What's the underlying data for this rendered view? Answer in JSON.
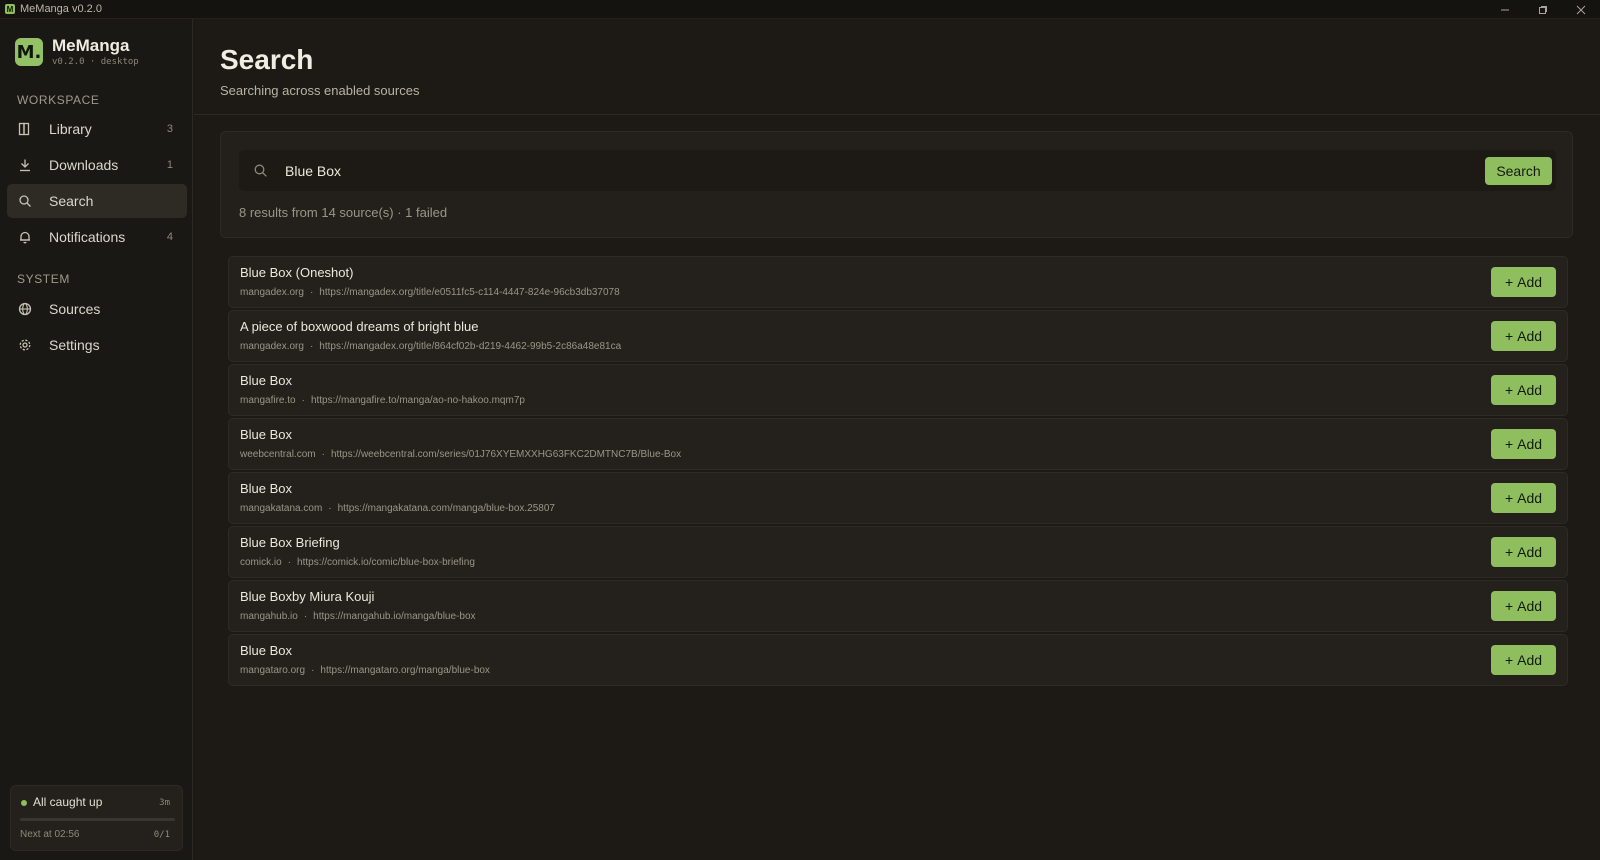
{
  "window": {
    "title": "MeManga v0.2.0",
    "logo_letter": "M",
    "controls": [
      "minimize-icon",
      "restore-icon",
      "close-icon"
    ]
  },
  "brand": {
    "logo_letter": "M.",
    "name": "MeManga",
    "version": "v0.2.0 · desktop",
    "accent_color": "#93c266"
  },
  "sidebar": {
    "workspace_label": "WORKSPACE",
    "workspace_items": [
      {
        "label": "Library",
        "count": "3",
        "icon": "book-icon"
      },
      {
        "label": "Downloads",
        "count": "1",
        "icon": "download-icon"
      },
      {
        "label": "Search",
        "count": "",
        "icon": "search-icon",
        "active": true
      },
      {
        "label": "Notifications",
        "count": "4",
        "icon": "bell-icon"
      }
    ],
    "system_label": "SYSTEM",
    "system_items": [
      {
        "label": "Sources",
        "icon": "globe-icon"
      },
      {
        "label": "Settings",
        "icon": "gear-icon"
      }
    ],
    "status": {
      "text": "All caught up",
      "age": "3m",
      "next": "Next at 02:56",
      "progress_text": "0/1",
      "progress_fraction": 0
    }
  },
  "page": {
    "title": "Search",
    "subtitle": "Searching across enabled sources"
  },
  "search": {
    "value": "Blue Box",
    "placeholder": "",
    "button_label": "Search",
    "summary": "8 results from 14 source(s)  ·  1 failed"
  },
  "results": [
    {
      "title": "Blue Box (Oneshot)",
      "source": "mangadex.org",
      "url": "https://mangadex.org/title/e0511fc5-c114-4447-824e-96cb3db37078"
    },
    {
      "title": "A piece of boxwood dreams of bright blue",
      "source": "mangadex.org",
      "url": "https://mangadex.org/title/864cf02b-d219-4462-99b5-2c86a48e81ca"
    },
    {
      "title": "Blue Box",
      "source": "mangafire.to",
      "url": "https://mangafire.to/manga/ao-no-hakoo.mqm7p"
    },
    {
      "title": "Blue Box",
      "source": "weebcentral.com",
      "url": "https://weebcentral.com/series/01J76XYEMXXHG63FKC2DMTNC7B/Blue-Box"
    },
    {
      "title": "Blue Box",
      "source": "mangakatana.com",
      "url": "https://mangakatana.com/manga/blue-box.25807"
    },
    {
      "title": "Blue Box Briefing",
      "source": "comick.io",
      "url": "https://comick.io/comic/blue-box-briefing"
    },
    {
      "title": "Blue Boxby Miura Kouji",
      "source": "mangahub.io",
      "url": "https://mangahub.io/manga/blue-box"
    },
    {
      "title": "Blue Box",
      "source": "mangataro.org",
      "url": "https://mangataro.org/manga/blue-box"
    }
  ],
  "add_label": "Add",
  "add_symbol": "+"
}
